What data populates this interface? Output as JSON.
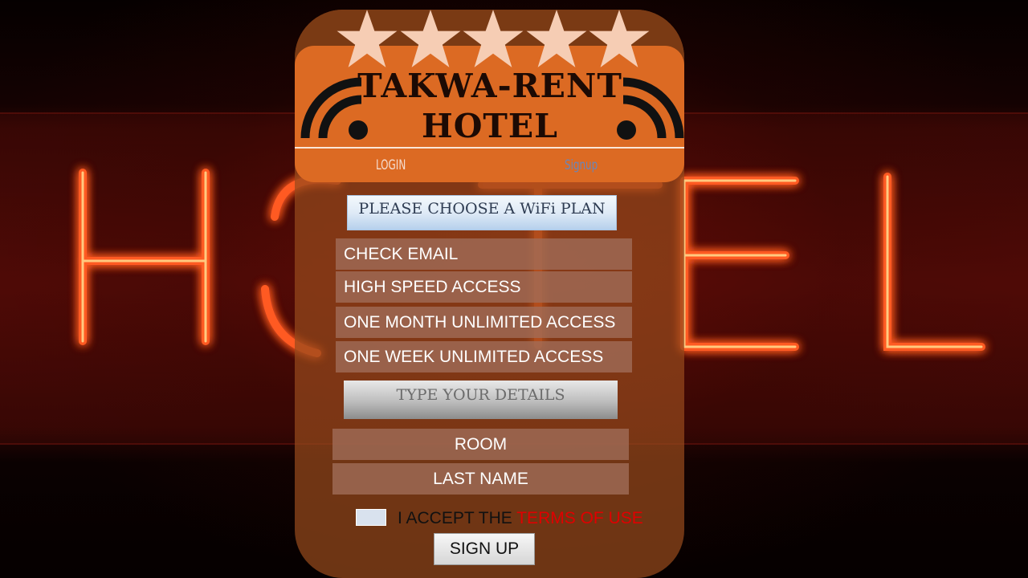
{
  "background": {
    "sign_letters": [
      "H",
      "O",
      "T",
      "E",
      "L"
    ],
    "neon_color": "#ff4a1c"
  },
  "header": {
    "stars": 5,
    "star_color": "#f6cdb4",
    "title_line1": "TAKWA-RENT",
    "title_line2": "HOTEL",
    "accent_color": "#dc6a23"
  },
  "nav": {
    "login_label": "LOGIN",
    "signup_label": "Signup"
  },
  "plans": {
    "heading": "PLEASE CHOOSE A WiFi PLAN",
    "options": [
      {
        "label": "CHECK EMAIL"
      },
      {
        "label": "HIGH SPEED ACCESS"
      },
      {
        "label": "ONE MONTH UNLIMITED ACCESS"
      },
      {
        "label": "ONE WEEK UNLIMITED ACCESS"
      }
    ]
  },
  "details": {
    "heading": "TYPE YOUR DETAILS",
    "fields": [
      {
        "placeholder": "ROOM"
      },
      {
        "placeholder": "LAST NAME"
      }
    ]
  },
  "terms": {
    "accept_text": "I ACCEPT THE",
    "link_text": "TERMS OF USE",
    "link_color": "#e00000",
    "checked": false
  },
  "signup_button": "SIGN UP"
}
